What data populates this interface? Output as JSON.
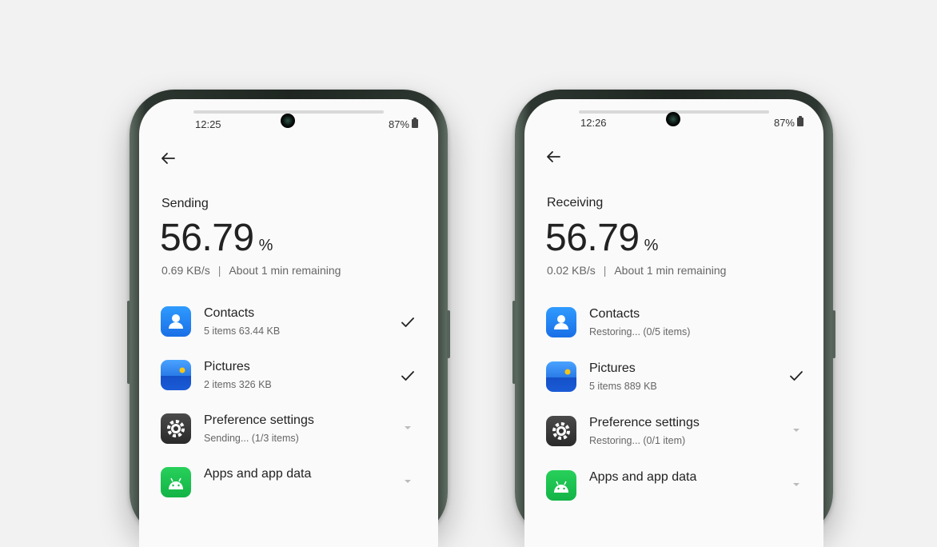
{
  "colors": {
    "accent_blue": "#1a6fe6",
    "apps_green": "#12b446",
    "sun_yellow": "#f5c518"
  },
  "phones": [
    {
      "time": "12:25",
      "battery": "87%",
      "mode_title": "Sending",
      "percent": "56.79",
      "percent_sign": "%",
      "speed": "0.69 KB/s",
      "separator": "|",
      "remaining": "About 1 min remaining",
      "items": [
        {
          "label": "Contacts",
          "meta": "5 items   63.44 KB",
          "icon": "contacts-icon",
          "status": "check"
        },
        {
          "label": "Pictures",
          "meta": "2 items   326 KB",
          "icon": "pictures-icon",
          "status": "check"
        },
        {
          "label": "Preference settings",
          "meta": "Sending... (1/3 items)",
          "icon": "settings-icon",
          "status": "expand"
        },
        {
          "label": "Apps and app data",
          "meta": "",
          "icon": "android-icon",
          "status": "expand"
        }
      ]
    },
    {
      "time": "12:26",
      "battery": "87%",
      "mode_title": "Receiving",
      "percent": "56.79",
      "percent_sign": "%",
      "speed": "0.02 KB/s",
      "separator": "|",
      "remaining": "About 1 min remaining",
      "items": [
        {
          "label": "Contacts",
          "meta": "Restoring... (0/5 items)",
          "icon": "contacts-icon",
          "status": "none"
        },
        {
          "label": "Pictures",
          "meta": "5 items   889 KB",
          "icon": "pictures-icon",
          "status": "check"
        },
        {
          "label": "Preference settings",
          "meta": "Restoring... (0/1 item)",
          "icon": "settings-icon",
          "status": "expand"
        },
        {
          "label": "Apps and app data",
          "meta": "",
          "icon": "android-icon",
          "status": "expand"
        }
      ]
    }
  ]
}
